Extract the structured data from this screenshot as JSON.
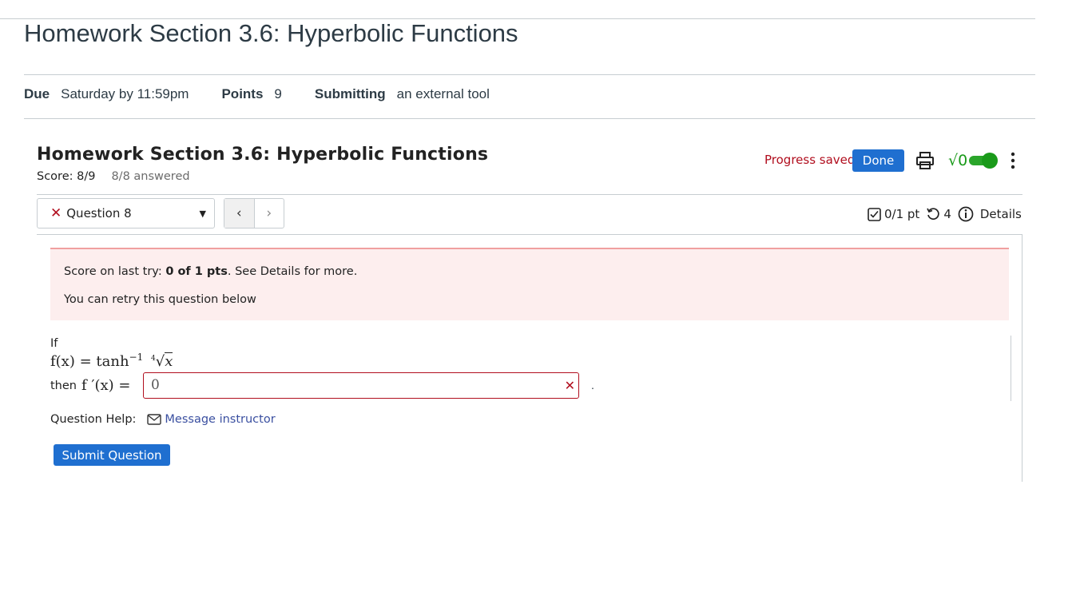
{
  "assignment": {
    "title": "Homework Section 3.6: Hyperbolic Functions",
    "due_label": "Due",
    "due_value": "Saturday by 11:59pm",
    "points_label": "Points",
    "points_value": "9",
    "submitting_label": "Submitting",
    "submitting_value": "an external tool"
  },
  "homework": {
    "title": "Homework Section 3.6: Hyperbolic Functions",
    "score": "Score: 8/9",
    "answered": "8/8 answered",
    "progress_status": "Progress saved",
    "done_label": "Done",
    "toggle_symbol": "√0"
  },
  "question_nav": {
    "selected_label": "Question 8",
    "status_icon": "x-icon",
    "prev_symbol": "‹",
    "next_symbol": "›"
  },
  "question_info": {
    "points": "0/1 pt",
    "retries": "4",
    "details_label": "Details"
  },
  "alert": {
    "line1_prefix": "Score on last try: ",
    "line1_bold": "0 of 1 pts",
    "line1_suffix": ". See Details for more.",
    "line2": "You can retry this question below"
  },
  "question": {
    "if_text": "If",
    "function_lhs": "f(x) = tanh",
    "function_exp": "−1",
    "root_index": "4",
    "root_radicand": "x",
    "then_text": "then",
    "derivative_lhs": "f ′(x) =",
    "answer_value": "0",
    "answer_status": "✕",
    "trailing_dot": "."
  },
  "help": {
    "label": "Question Help:",
    "message_link": "Message instructor"
  },
  "submit_label": "Submit Question"
}
